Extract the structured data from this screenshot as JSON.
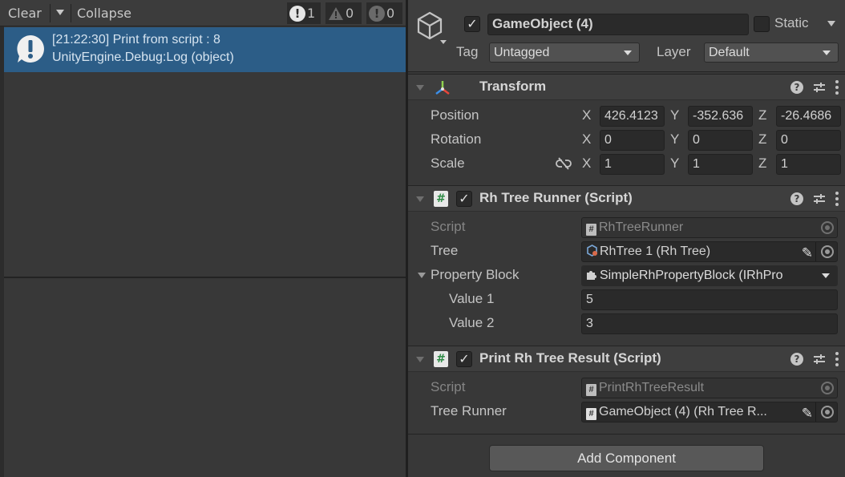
{
  "console": {
    "clear_label": "Clear",
    "collapse_label": "Collapse",
    "counts": {
      "info": "1",
      "warnings": "0",
      "errors": "0"
    },
    "entry": {
      "line1": "[21:22:30] Print from script : 8",
      "line2": "UnityEngine.Debug:Log (object)"
    }
  },
  "inspector": {
    "gameobject_name": "GameObject (4)",
    "static_label": "Static",
    "tag_label": "Tag",
    "tag_value": "Untagged",
    "layer_label": "Layer",
    "layer_value": "Default",
    "transform": {
      "title": "Transform",
      "position_label": "Position",
      "rotation_label": "Rotation",
      "scale_label": "Scale",
      "axis_x": "X",
      "axis_y": "Y",
      "axis_z": "Z",
      "position": {
        "x": "426.4123",
        "y": "-352.636",
        "z": "-26.4686"
      },
      "rotation": {
        "x": "0",
        "y": "0",
        "z": "0"
      },
      "scale": {
        "x": "1",
        "y": "1",
        "z": "1"
      }
    },
    "rh_tree_runner": {
      "title": "Rh Tree Runner (Script)",
      "script_label": "Script",
      "script_value": "RhTreeRunner",
      "tree_label": "Tree",
      "tree_value": "RhTree 1 (Rh Tree)",
      "property_block_label": "Property Block",
      "property_block_value": "SimpleRhPropertyBlock (IRhPro",
      "value1_label": "Value 1",
      "value1": "5",
      "value2_label": "Value 2",
      "value2": "3"
    },
    "print_result": {
      "title": "Print Rh Tree Result (Script)",
      "script_label": "Script",
      "script_value": "PrintRhTreeResult",
      "runner_label": "Tree Runner",
      "runner_value": "GameObject (4) (Rh Tree R..."
    },
    "add_component_label": "Add Component"
  }
}
